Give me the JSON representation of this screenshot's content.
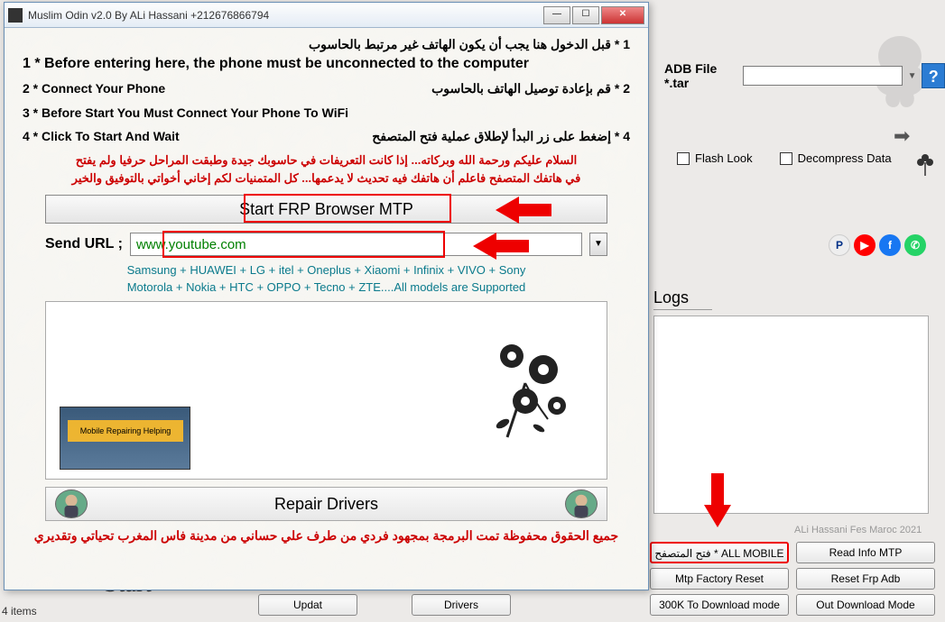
{
  "bg": {
    "adb_label": "ADB File *.tar",
    "help": "?",
    "flash_look": "Flash Look",
    "decompress": "Decompress Data",
    "logs_label": "Logs",
    "credit": "ALi Hassani Fes Maroc 2021",
    "buttons": {
      "all_mobile": "فتح المتصفح * ALL MOBILE FRP",
      "read_info": "Read Info MTP",
      "factory_reset": "Mtp Factory Reset",
      "reset_frp": "Reset Frp Adb",
      "download_mode": "300K To Download mode",
      "out_download": "Out Download Mode",
      "updat": "Updat",
      "drivers_b": "Drivers"
    },
    "partial_start": "Start",
    "items": "4 items",
    "partial_btn1": "",
    "partial_btn2": ""
  },
  "dialog": {
    "title": "Muslim Odin v2.0 By ALi Hassani +212676866794",
    "instr1_ar": "1 * قبل الدخول هنا يجب أن يكون الهاتف غير مرتبط بالحاسوب",
    "instr1_en": "1 * Before entering here, the phone must be unconnected to the computer",
    "instr2_en": "2 * Connect Your Phone",
    "instr2_ar": "2 * قم بإعادة توصيل الهاتف بالحاسوب",
    "instr3": "3 * Before Start You Must Connect Your Phone To WiFi",
    "instr4_en": "4 * Click To Start And Wait",
    "instr4_ar": "4 * إضغط على زر البدأ لإطلاق عملية فتح المتصفح",
    "red1": "السلام عليكم ورحمة الله وبركاته... إذا كانت التعريفات في حاسوبك جيدة وطبقت المراحل حرفيا ولم يفتح",
    "red2": "في هاتفك المتصفح فاعلم أن هاتفك فيه تحديث لا يدعمها... كل المتمنيات لكم إخاني أخواتي بالتوفيق والخير",
    "start_btn": "Start FRP Browser MTP",
    "send_label": "Send URL ;",
    "send_value": "www.youtube.com",
    "supported1": "Samsung + HUAWEI + LG + itel + Oneplus + Xiaomi + Infinix + VIVO + Sony",
    "supported2": "Motorola + Nokia + HTC + OPPO + Tecno + ZTE....All models are Supported",
    "mobile_text": "Mobile Repairing Helping",
    "repair": "Repair Drivers",
    "copyright": "جميع الحقوق محفوظة تمت البرمجة بمجهود فردي من طرف علي حساني من مدينة فاس المغرب  تحياتي وتقديري"
  }
}
